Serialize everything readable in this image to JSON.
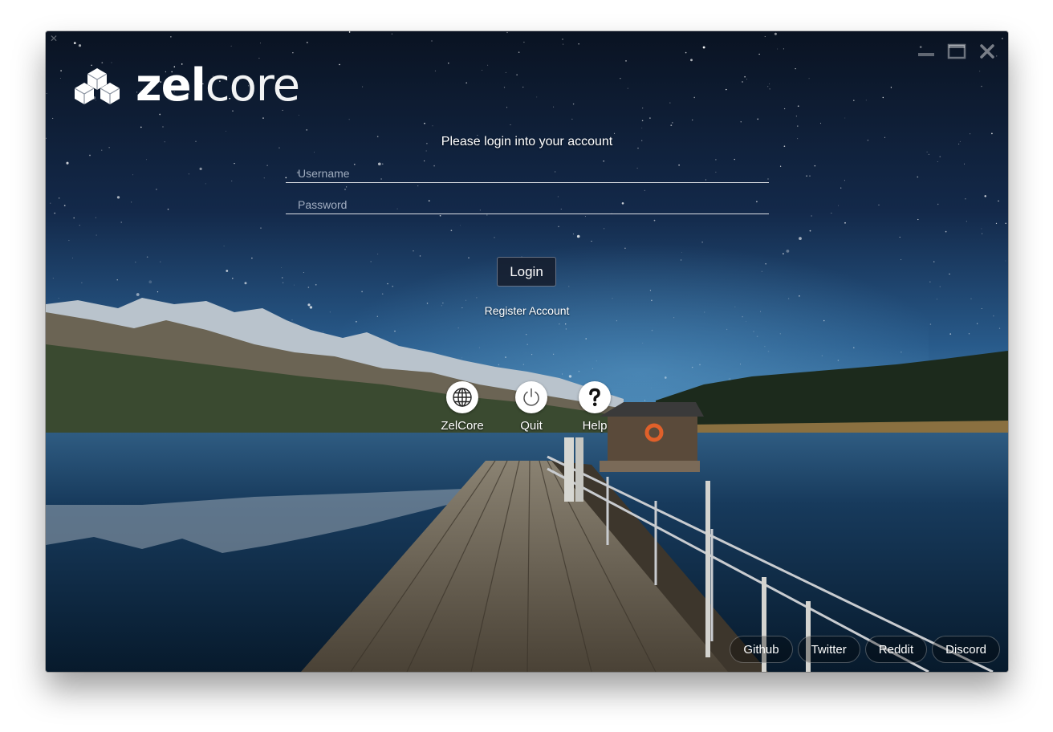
{
  "window": {
    "controls": [
      "minimize-icon",
      "maximize-icon",
      "close-icon"
    ],
    "corner_icon": "move-icon"
  },
  "brand": {
    "logo_icon": "cubes-logo-icon",
    "name_bold": "zel",
    "name_light": "core"
  },
  "login": {
    "prompt": "Please login into your account",
    "username_placeholder": "Username",
    "username_value": "",
    "password_placeholder": "Password",
    "password_value": "",
    "button_label": "Login",
    "register_label": "Register Account"
  },
  "actions": [
    {
      "label": "ZelCore",
      "icon": "globe-icon"
    },
    {
      "label": "Quit",
      "icon": "power-icon"
    },
    {
      "label": "Help",
      "icon": "question-icon"
    }
  ],
  "social": [
    {
      "label": "Github"
    },
    {
      "label": "Twitter"
    },
    {
      "label": "Reddit"
    },
    {
      "label": "Discord"
    }
  ],
  "colors": {
    "text": "#ffffff",
    "sky_top": "#0b1626",
    "sky_horizon": "#2a5f8f",
    "water": "#0d2c4a",
    "button_bg": "#161e2e"
  }
}
